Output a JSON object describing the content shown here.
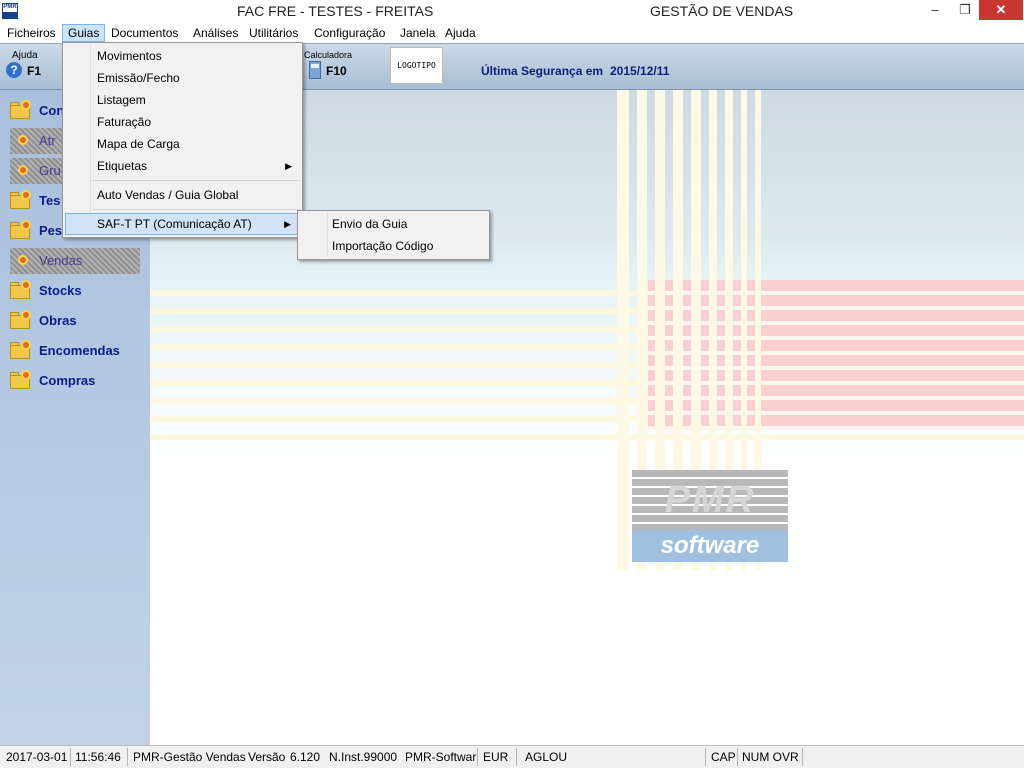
{
  "titlebar": {
    "icon_text": "PMR",
    "title_left": "FAC FRE - TESTES - FREITAS",
    "title_right": "GESTÃO DE VENDAS",
    "minimize": "–",
    "maximize": "❐",
    "close": "✕"
  },
  "menubar": [
    "Ficheiros",
    "Guias",
    "Documentos",
    "Análises",
    "Utilitários",
    "Configuração",
    "Janela",
    "Ajuda"
  ],
  "toolbar": {
    "help_label": "Ajuda",
    "help_key": "F1",
    "help_glyph": "?",
    "calc_label": "Calculadora",
    "calc_key": "F10",
    "logo": "LOGOTIPO",
    "backup_label": "Última Segurança em",
    "backup_date": "2015/12/11"
  },
  "sidebar": [
    {
      "label": "Con",
      "enabled": true
    },
    {
      "label": "Atr",
      "enabled": false
    },
    {
      "label": "Gru",
      "enabled": false
    },
    {
      "label": "Tes",
      "enabled": true
    },
    {
      "label": "Pes",
      "enabled": true
    },
    {
      "label": "Vendas",
      "enabled": false
    },
    {
      "label": "Stocks",
      "enabled": true
    },
    {
      "label": "Obras",
      "enabled": true
    },
    {
      "label": "Encomendas",
      "enabled": true
    },
    {
      "label": "Compras",
      "enabled": true
    }
  ],
  "dropdown": {
    "items": [
      "Movimentos",
      "Emissão/Fecho",
      "Listagem",
      "Faturação",
      "Mapa de Carga",
      "Etiquetas",
      "Auto Vendas / Guia Global",
      "SAF-T PT (Comunicação AT)"
    ],
    "arrow": "▶"
  },
  "submenu": [
    "Envio da Guia",
    "Importação Código"
  ],
  "watermark": {
    "pmr": "PMR",
    "software": "software"
  },
  "statusbar": {
    "date": "2017-03-01",
    "time": "11:56:46",
    "app": "PMR-Gestão Vendas",
    "version_label": "Versão",
    "version": "6.120",
    "inst": "N.Inst.99000",
    "vendor": "PMR-Softwar",
    "currency": "EUR",
    "user": "AGLOU",
    "cap": "CAP",
    "num_ovr": "NUM OVR"
  },
  "colors": {
    "sidebar_text": "#0a1a8f",
    "backup_text": "#0b1f7a",
    "close_button": "#c7372f",
    "menu_highlight": "#d1e3f6"
  }
}
